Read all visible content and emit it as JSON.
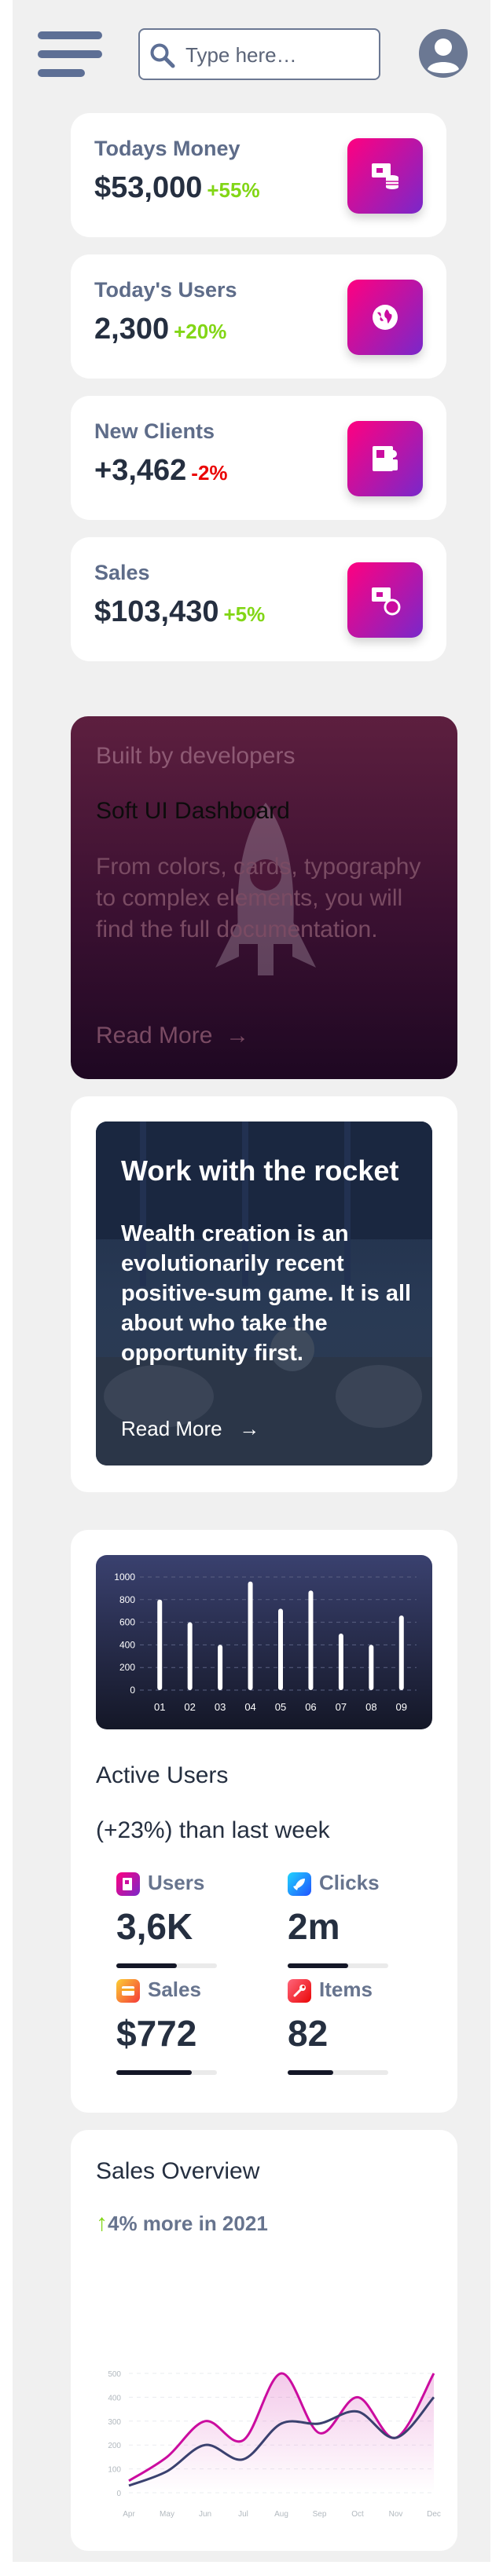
{
  "header": {
    "search_placeholder": "Type here…"
  },
  "stats": [
    {
      "label": "Todays Money",
      "value": "$53,000",
      "change": "+55%",
      "trend": "up",
      "icon": "money-icon"
    },
    {
      "label": "Today's Users",
      "value": "2,300",
      "change": "+20%",
      "trend": "up",
      "icon": "globe-icon"
    },
    {
      "label": "New Clients",
      "value": "+3,462",
      "change": "-2%",
      "trend": "down",
      "icon": "document-icon"
    },
    {
      "label": "Sales",
      "value": "$103,430",
      "change": "+5%",
      "trend": "up",
      "icon": "cart-icon"
    }
  ],
  "developer_card": {
    "kicker": "Built by developers",
    "title": "Soft UI Dashboard",
    "description": "From colors, cards, typography to complex elements, you will find the full documentation.",
    "link_label": "Read More",
    "link_arrow": "→"
  },
  "rocket_card": {
    "title": "Work with the rocket",
    "description": "Wealth creation is an evolutionarily recent positive-sum game. It is all about who take the opportunity first.",
    "link_label": "Read More",
    "link_arrow": "→"
  },
  "active_users": {
    "title": "Active Users",
    "subtitle": "(+23%) than last week",
    "metrics": [
      {
        "label": "Users",
        "value": "3,6K",
        "progress": 0.6,
        "color": "#cb0c9f"
      },
      {
        "label": "Clicks",
        "value": "2m",
        "progress": 0.6,
        "color": "#17c1e8"
      },
      {
        "label": "Sales",
        "value": "$772",
        "progress": 0.75,
        "color": "#fbcf33"
      },
      {
        "label": "Items",
        "value": "82",
        "progress": 0.45,
        "color": "#ea0606"
      }
    ]
  },
  "sales_overview": {
    "title": "Sales Overview",
    "arrow": "↑",
    "subtitle": "4% more in 2021"
  },
  "chart_data": [
    {
      "type": "bar",
      "categories": [
        "01",
        "02",
        "03",
        "04",
        "05",
        "06",
        "07",
        "08",
        "09"
      ],
      "values": [
        800,
        600,
        400,
        960,
        720,
        880,
        500,
        400,
        660
      ],
      "yticks": [
        0,
        200,
        400,
        600,
        800,
        1000
      ],
      "ylim": [
        0,
        1000
      ],
      "bar_color": "#ffffff",
      "grid": true
    },
    {
      "type": "line",
      "categories": [
        "Apr",
        "May",
        "Jun",
        "Jul",
        "Aug",
        "Sep",
        "Oct",
        "Nov",
        "Dec"
      ],
      "yticks": [
        0,
        100,
        200,
        300,
        400,
        500
      ],
      "ylim": [
        0,
        500
      ],
      "series": [
        {
          "values": [
            50,
            150,
            300,
            220,
            500,
            250,
            400,
            230,
            500
          ],
          "color": "#cb0c9f"
        },
        {
          "values": [
            30,
            90,
            200,
            140,
            290,
            290,
            340,
            230,
            400
          ],
          "color": "#3a416f"
        }
      ],
      "grid": true
    }
  ]
}
